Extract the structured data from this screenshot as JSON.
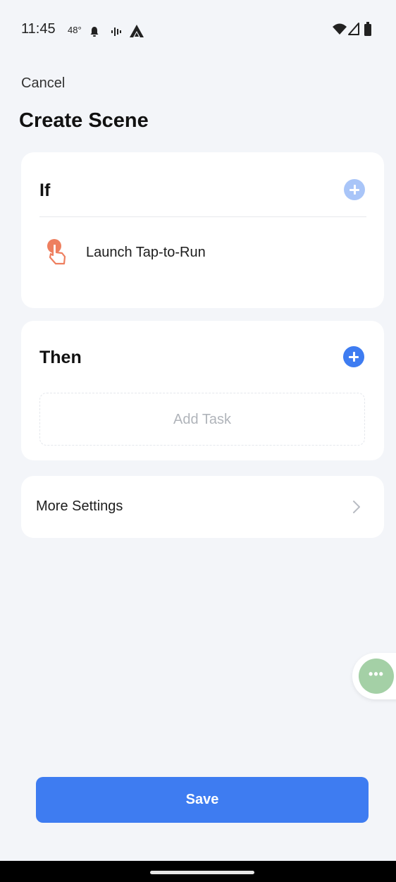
{
  "status_bar": {
    "time": "11:45",
    "temperature": "48°",
    "icons": [
      "notification-bell-icon",
      "voice-waveform-icon",
      "arrow-app-icon",
      "wifi-icon",
      "cellular-signal-icon",
      "battery-icon"
    ]
  },
  "header": {
    "cancel_label": "Cancel",
    "title": "Create Scene"
  },
  "if_section": {
    "title": "If",
    "condition": {
      "icon": "tap-hand-icon",
      "label": "Launch Tap-to-Run"
    }
  },
  "then_section": {
    "title": "Then",
    "add_task_label": "Add Task"
  },
  "more_settings": {
    "label": "More Settings"
  },
  "floating_button": {
    "icon": "more-dots-icon",
    "label": "•••"
  },
  "footer": {
    "save_label": "Save"
  },
  "colors": {
    "accent": "#3e7cf1",
    "accent_disabled": "#a9c5f8",
    "background": "#f3f5f9",
    "card": "#ffffff",
    "tap_icon": "#ee7f5f",
    "floating_button": "#a4d0a6"
  }
}
